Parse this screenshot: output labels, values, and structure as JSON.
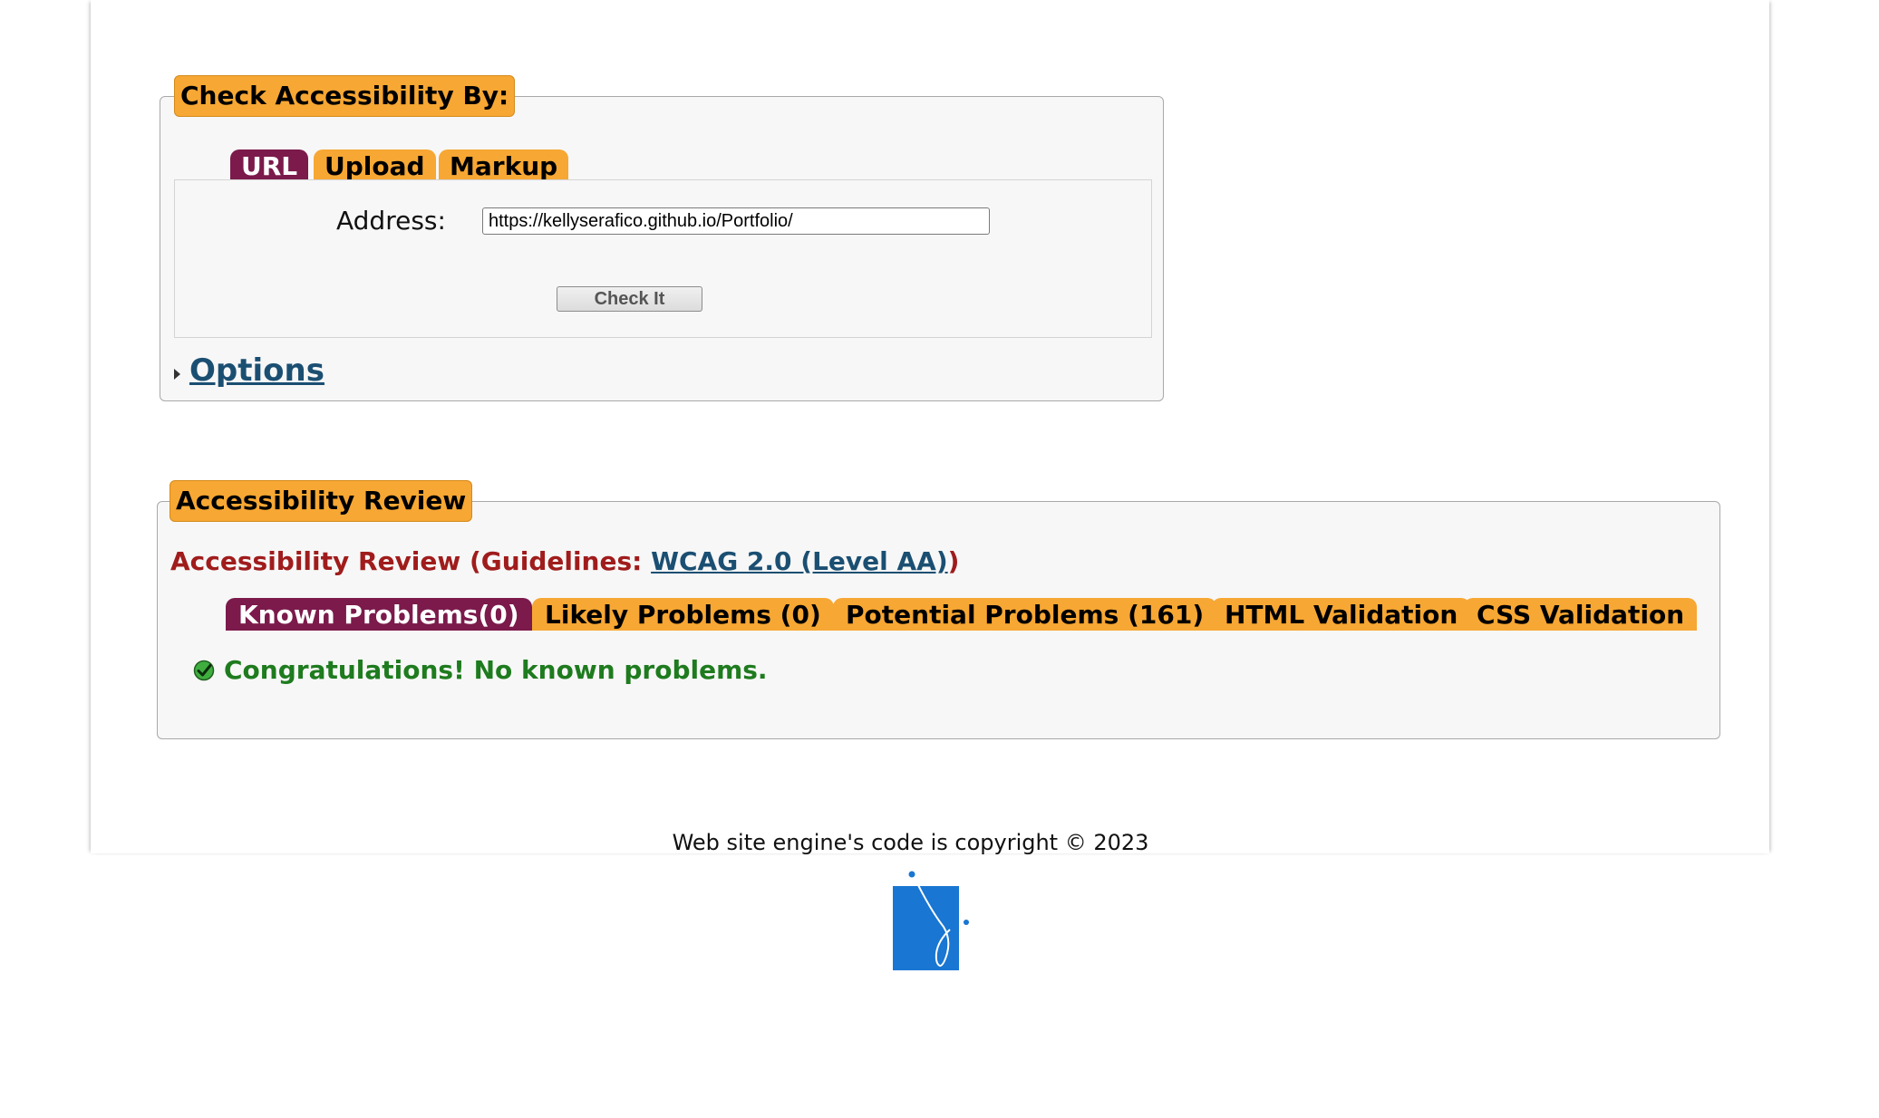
{
  "check_section": {
    "legend": "Check Accessibility By:",
    "tabs": [
      {
        "label": "URL",
        "active": true
      },
      {
        "label": "Upload",
        "active": false
      },
      {
        "label": "Markup",
        "active": false
      }
    ],
    "address_label": "Address:",
    "address_value": "https://kellyserafico.github.io/Portfolio/",
    "check_button": "Check It",
    "options_label": "Options"
  },
  "review_section": {
    "legend": "Accessibility Review",
    "heading_prefix": "Accessibility Review (Guidelines: ",
    "guideline_link": "WCAG 2.0 (Level AA)",
    "heading_suffix": ")",
    "tabs": [
      {
        "label": "Known Problems(0)",
        "active": true
      },
      {
        "label": "Likely Problems (0)",
        "active": false
      },
      {
        "label": "Potential Problems (161)",
        "active": false
      },
      {
        "label": "HTML Validation",
        "active": false
      },
      {
        "label": "CSS Validation",
        "active": false
      }
    ],
    "result_message": "Congratulations! No known problems."
  },
  "footer": {
    "copyright": "Web site engine's code is copyright © 2023"
  },
  "colors": {
    "tab_orange": "#f7a733",
    "tab_active": "#7b1a4b",
    "heading_red": "#a01c1c",
    "link_blue": "#1b4f72",
    "success_green": "#1e7b1e",
    "logo_blue": "#1976d2"
  }
}
